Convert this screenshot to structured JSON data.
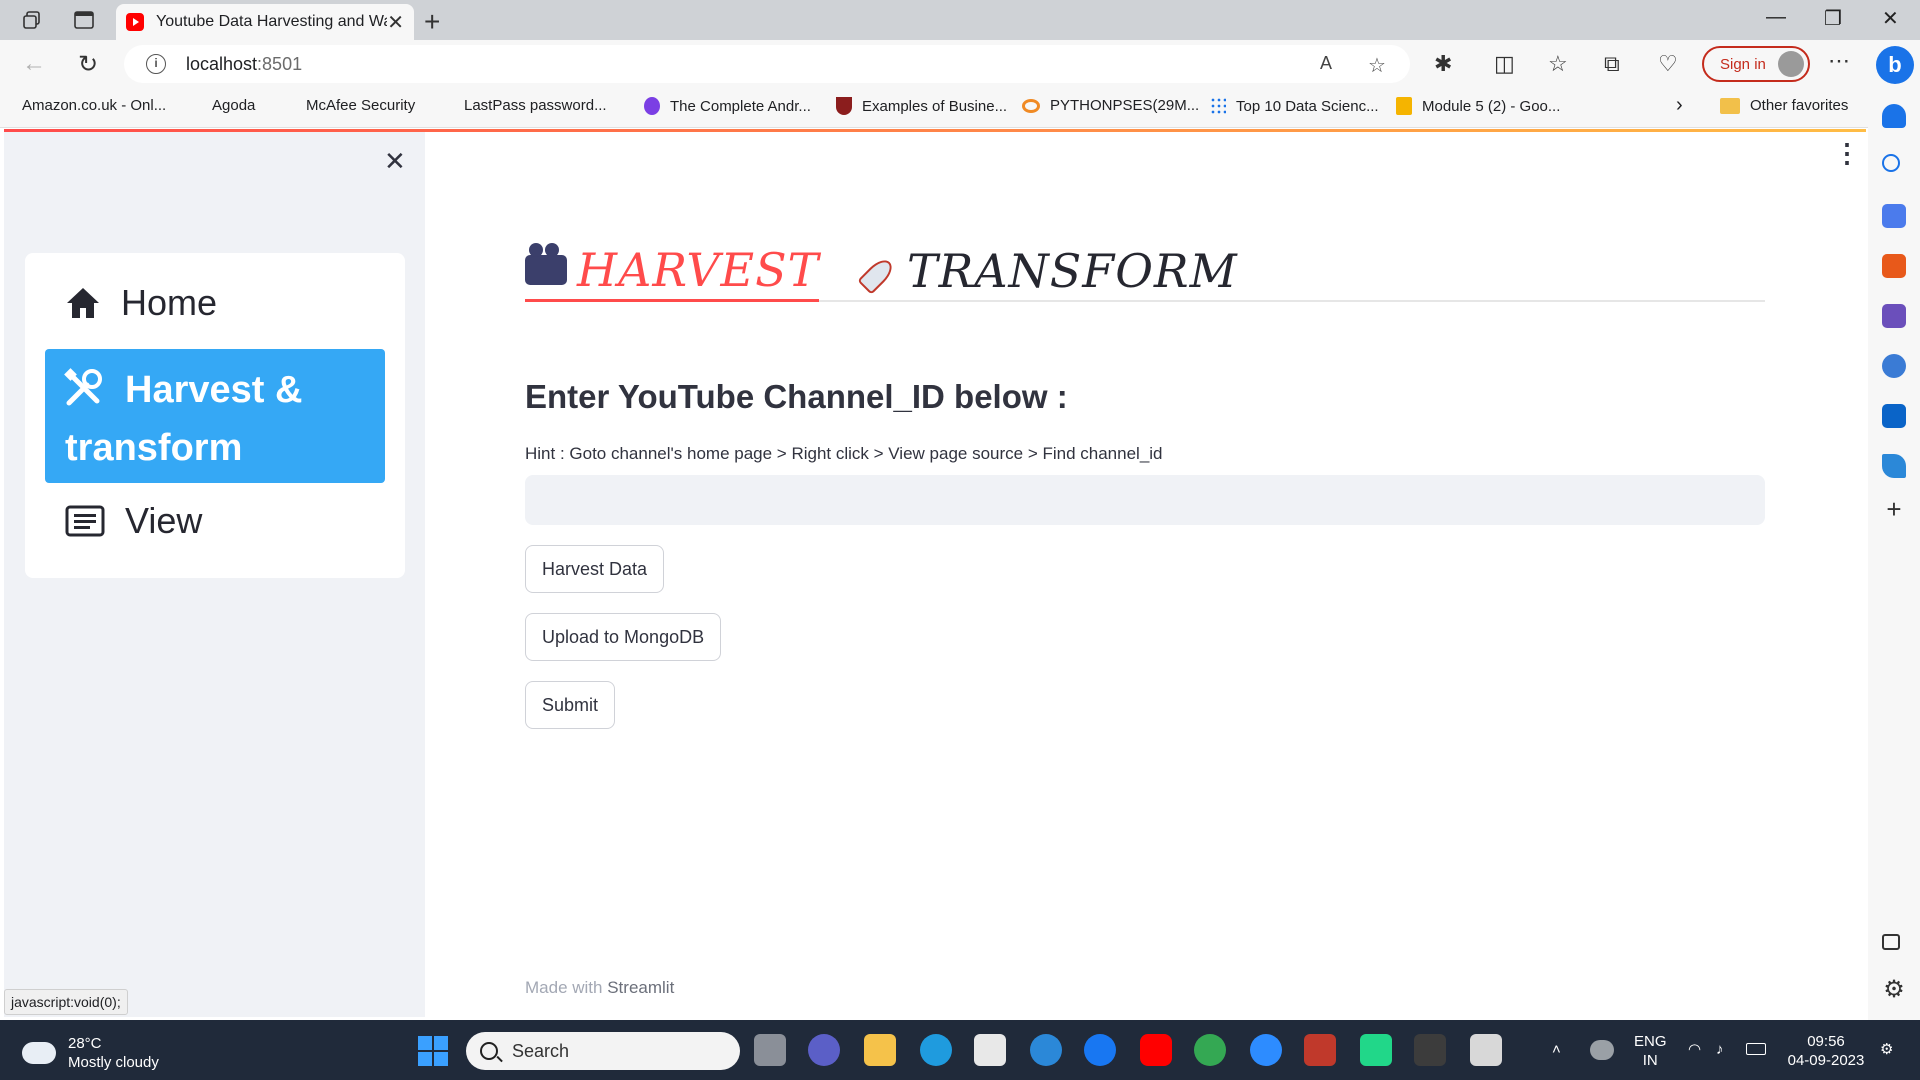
{
  "browser": {
    "tab_title": "Youtube Data Harvesting and Warehousing",
    "url_host": "localhost",
    "url_port": ":8501",
    "signin_label": "Sign in",
    "bing_label": "b",
    "favorites": [
      {
        "label": "Amazon.co.uk - Onl...",
        "icon": "page-icon"
      },
      {
        "label": "Agoda",
        "icon": "page-icon"
      },
      {
        "label": "McAfee Security",
        "icon": "page-icon"
      },
      {
        "label": "LastPass password...",
        "icon": "page-icon"
      },
      {
        "label": "The Complete Andr...",
        "icon": "udemy-icon"
      },
      {
        "label": "Examples of Busine...",
        "icon": "crest-icon"
      },
      {
        "label": "PYTHONPSES(29M...",
        "icon": "coursera-icon"
      },
      {
        "label": "Top 10 Data Scienc...",
        "icon": "dots-icon"
      },
      {
        "label": "Module 5 (2) - Goo...",
        "icon": "slides-icon"
      }
    ],
    "other_favorites": "Other favorites"
  },
  "sidebar": {
    "items": [
      {
        "label": "Home",
        "icon": "home-icon",
        "selected": false
      },
      {
        "label_line1": "Harvest &",
        "label_line2": "transform",
        "icon": "tools-icon",
        "selected": true
      },
      {
        "label": "View",
        "icon": "list-icon",
        "selected": false
      }
    ]
  },
  "main": {
    "tabs": [
      {
        "label": "HARVEST",
        "icon": "movie-camera-icon",
        "active": true
      },
      {
        "label": "TRANSFORM",
        "icon": "rocket-icon",
        "active": false
      }
    ],
    "heading": "Enter YouTube Channel_ID below :",
    "hint": "Hint : Goto channel's home page > Right click > View page source > Find channel_id",
    "channel_input_value": "",
    "buttons": {
      "harvest": "Harvest Data",
      "upload": "Upload to MongoDB",
      "submit": "Submit"
    },
    "footer_prefix": "Made with",
    "footer_brand": "Streamlit"
  },
  "statusbar": "javascript:void(0);",
  "taskbar": {
    "temp": "28°C",
    "weather": "Mostly cloudy",
    "search_label": "Search",
    "lang1": "ENG",
    "lang2": "IN",
    "time": "09:56",
    "date": "04-09-2023"
  },
  "colors": {
    "accent_red": "#ff4b4b",
    "menu_selected": "#35a8f5",
    "sidebar_bg": "#f0f2f6"
  }
}
